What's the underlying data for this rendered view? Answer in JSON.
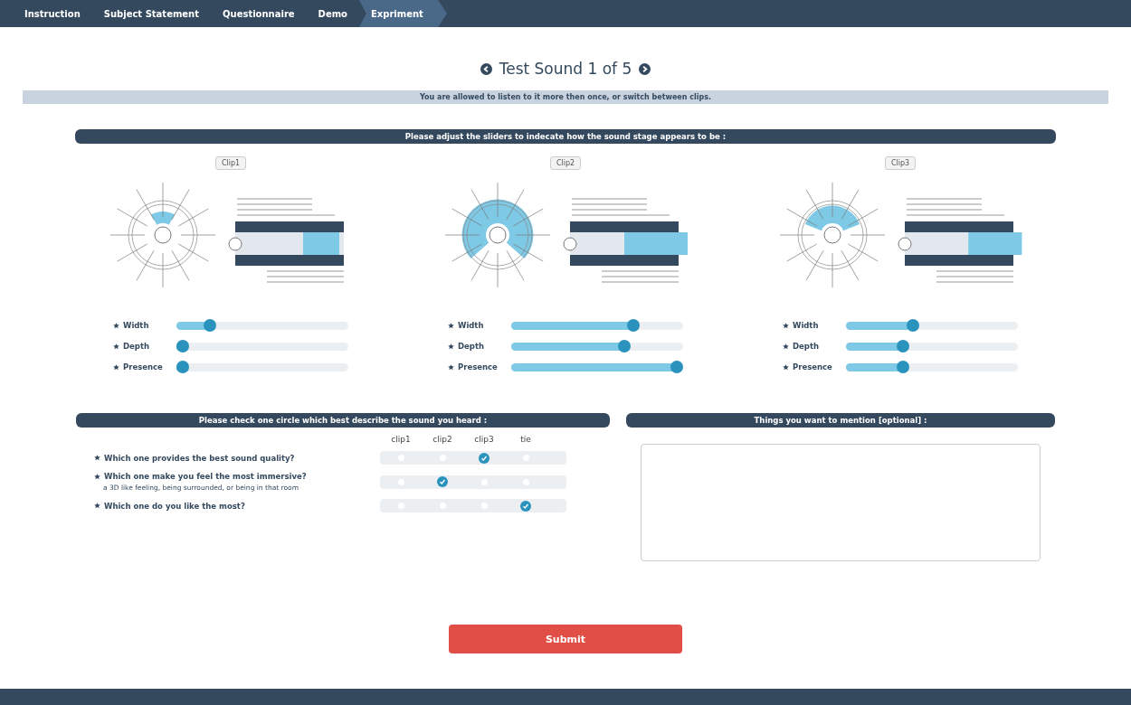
{
  "nav": [
    {
      "label": "Instruction",
      "selected": false
    },
    {
      "label": "Subject Statement",
      "selected": false
    },
    {
      "label": "Questionnaire",
      "selected": false
    },
    {
      "label": "Demo",
      "selected": false
    },
    {
      "label": "Expriment",
      "selected": true
    }
  ],
  "title": "Test Sound 1 of 5",
  "notice": "You are allowed to listen to it more then once, or switch between clips.",
  "sliders_heading": "Please adjust the sliders to indecate how the sound stage appears to be :",
  "clips": [
    {
      "button": "Clip1",
      "sliders": [
        {
          "label": "Width",
          "level": 0.17
        },
        {
          "label": "Depth",
          "level": 0
        },
        {
          "label": "Presence",
          "level": 0
        }
      ]
    },
    {
      "button": "Clip2",
      "sliders": [
        {
          "label": "Width",
          "level": 0.73
        },
        {
          "label": "Depth",
          "level": 0.67
        },
        {
          "label": "Presence",
          "level": 1
        }
      ]
    },
    {
      "button": "Clip3",
      "sliders": [
        {
          "label": "Width",
          "level": 0.38
        },
        {
          "label": "Depth",
          "level": 0.32
        },
        {
          "label": "Presence",
          "level": 0.32
        }
      ]
    }
  ],
  "questions_heading": "Please check one circle which best describe the sound you heard :",
  "columns": [
    "clip1",
    "clip2",
    "clip3",
    "tie"
  ],
  "questions": [
    {
      "text": "Which one provides the best sound quality?",
      "options": [
        {
          "selected": false
        },
        {
          "selected": false
        },
        {
          "selected": true
        },
        {
          "selected": false
        }
      ]
    },
    {
      "text": "Which one make you feel the most immersive?",
      "note": "a 3D like feeling, being surrounded, or being in that room",
      "options": [
        {
          "selected": false
        },
        {
          "selected": true
        },
        {
          "selected": false
        },
        {
          "selected": false
        }
      ]
    },
    {
      "text": "Which one do you like the most?",
      "options": [
        {
          "selected": false
        },
        {
          "selected": false
        },
        {
          "selected": false
        },
        {
          "selected": true
        }
      ]
    }
  ],
  "comments_heading": "Things you want to mention [optional] :",
  "submit": "Submit"
}
